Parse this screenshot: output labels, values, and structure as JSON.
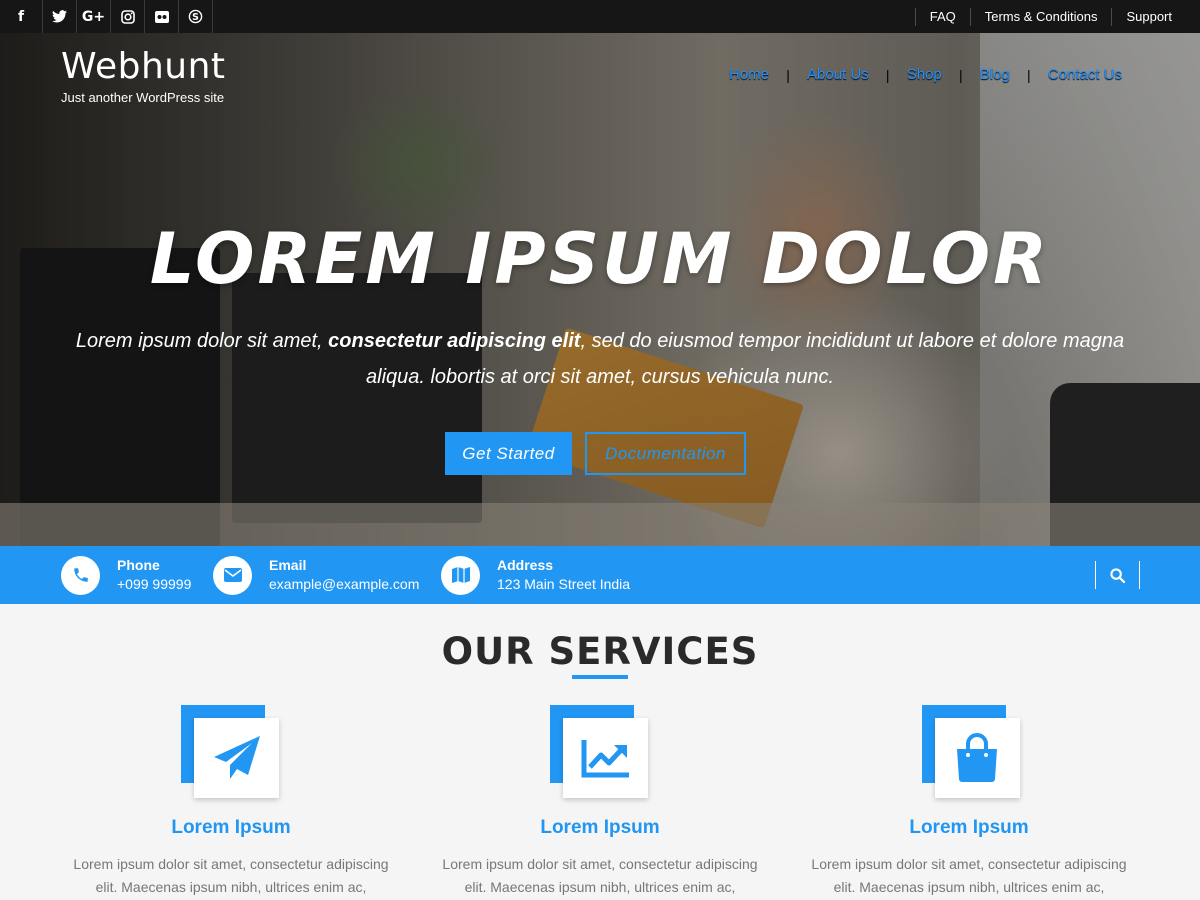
{
  "topbar": {
    "social": [
      {
        "glyph": "f",
        "icon": "facebook-icon"
      },
      {
        "glyph": "𝕥",
        "icon": "twitter-icon"
      },
      {
        "glyph": "G+",
        "icon": "google-plus-icon"
      },
      {
        "glyph": "◎",
        "icon": "instagram-icon"
      },
      {
        "glyph": "●●",
        "icon": "flickr-icon"
      },
      {
        "glyph": "S",
        "icon": "skype-icon"
      }
    ],
    "links": [
      "FAQ",
      "Terms & Conditions",
      "Support"
    ]
  },
  "brand": {
    "title": "Webhunt",
    "tagline": "Just another WordPress site"
  },
  "nav": {
    "items": [
      "Home",
      "About Us",
      "Shop",
      "Blog",
      "Contact Us"
    ],
    "separator": "|"
  },
  "hero": {
    "title": "LOREM IPSUM DOLOR",
    "subtitle_pre": "Lorem ipsum dolor sit amet, ",
    "subtitle_bold": "consectetur adipiscing elit",
    "subtitle_post": ", sed do eiusmod tempor incididunt ut labore et dolore magna aliqua. lobortis at orci sit amet, cursus vehicula nunc.",
    "primary_button": "Get Started",
    "secondary_button": "Documentation"
  },
  "infobar": {
    "phone": {
      "label": "Phone",
      "value": "+099 99999",
      "icon": "phone-icon"
    },
    "email": {
      "label": "Email",
      "value": "example@example.com",
      "icon": "envelope-icon"
    },
    "address": {
      "label": "Address",
      "value": "123 Main Street India",
      "icon": "map-icon"
    },
    "search_icon": "search-icon"
  },
  "services": {
    "title": "OUR SERVICES",
    "items": [
      {
        "icon": "paper-plane-icon",
        "title": "Lorem Ipsum",
        "text_line1": "Lorem ipsum dolor sit amet, consectetur adipiscing",
        "text_line2": "elit. Maecenas ipsum nibh, ultrices enim ac,"
      },
      {
        "icon": "line-chart-icon",
        "title": "Lorem Ipsum",
        "text_line1": "Lorem ipsum dolor sit amet, consectetur adipiscing",
        "text_line2": "elit. Maecenas ipsum nibh, ultrices enim ac,"
      },
      {
        "icon": "shopping-bag-icon",
        "title": "Lorem Ipsum",
        "text_line1": "Lorem ipsum dolor sit amet, consectetur adipiscing",
        "text_line2": "elit. Maecenas ipsum nibh, ultrices enim ac,"
      }
    ]
  },
  "colors": {
    "accent": "#2196f3",
    "topbar": "#161616",
    "heading": "#2a2a2a"
  }
}
